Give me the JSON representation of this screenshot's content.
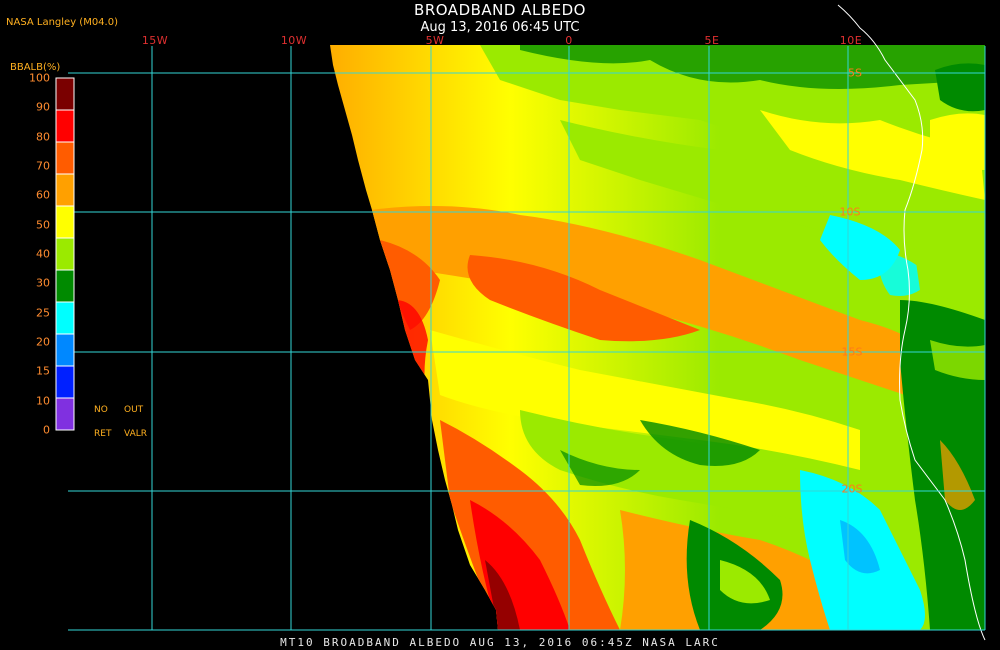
{
  "header": {
    "title": "BROADBAND ALBEDO",
    "subtitle": "Aug 13, 2016 06:45 UTC",
    "source": "NASA Langley (M04.0)"
  },
  "map": {
    "longitude_labels": [
      "15W",
      "10W",
      "5W",
      "0",
      "5E",
      "10E"
    ],
    "latitude_labels": [
      "5S",
      "10S",
      "15S",
      "20S"
    ],
    "grid_color": "#33d6d6",
    "background": "#000000",
    "land_boundary_color": "#ffffff"
  },
  "colorbar": {
    "title": "BBALB(%)",
    "ticks": [
      "100",
      "90",
      "80",
      "70",
      "60",
      "50",
      "40",
      "30",
      "25",
      "20",
      "15",
      "10",
      "0"
    ],
    "colors": [
      "#7a0000",
      "#ff0000",
      "#ff5c00",
      "#ffa000",
      "#ffff00",
      "#9bea00",
      "#008a00",
      "#00ffff",
      "#0088ff",
      "#0020ff",
      "#8030e0"
    ],
    "notes": {
      "no_label": "NO",
      "out_label": "OUT",
      "ret_label": "RET",
      "valr_label": "VALR"
    }
  },
  "footer": {
    "text": "MT10  BROADBAND ALBEDO   AUG 13, 2016 06:45Z   NASA LARC"
  }
}
